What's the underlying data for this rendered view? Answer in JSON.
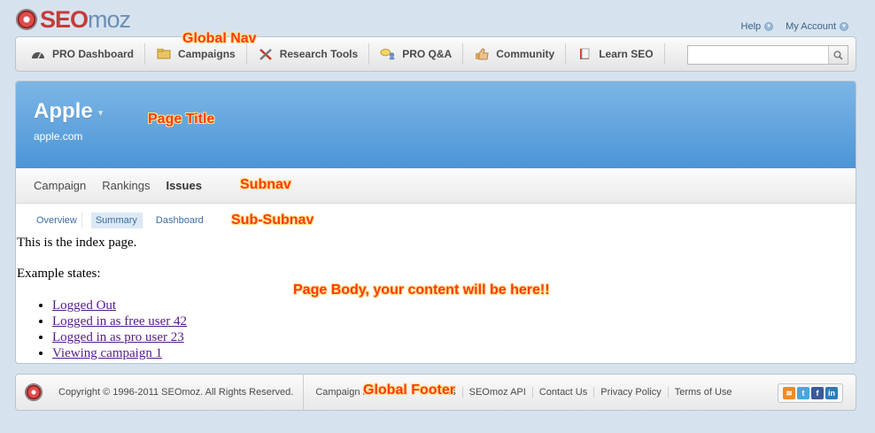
{
  "logo": {
    "part1": "SEO",
    "part2": "moz"
  },
  "top_links": [
    {
      "label": "Help"
    },
    {
      "label": "My Account"
    }
  ],
  "global_nav": {
    "items": [
      {
        "label": "PRO Dashboard",
        "icon": "speedometer-icon"
      },
      {
        "label": "Campaigns",
        "icon": "folder-icon"
      },
      {
        "label": "Research Tools",
        "icon": "tools-icon"
      },
      {
        "label": "PRO Q&A",
        "icon": "chat-icon"
      },
      {
        "label": "Community",
        "icon": "thumbs-up-icon"
      },
      {
        "label": "Learn SEO",
        "icon": "book-icon"
      }
    ],
    "search_placeholder": ""
  },
  "page": {
    "title": "Apple",
    "subtitle": "apple.com"
  },
  "subnav": [
    {
      "label": "Campaign"
    },
    {
      "label": "Rankings"
    },
    {
      "label": "Issues",
      "active": true
    }
  ],
  "subsubnav": [
    {
      "label": "Overview"
    },
    {
      "label": "Summary",
      "active": true
    },
    {
      "label": "Dashboard"
    }
  ],
  "body": {
    "intro": "This is the index page.",
    "example_heading": "Example states:",
    "links": [
      "Logged Out",
      "Logged in as free user 42",
      "Logged in as pro user 23",
      "Viewing campaign 1"
    ]
  },
  "footer": {
    "copyright": "Copyright © 1996-2011 SEOmoz. All Rights Reserved.",
    "links": [
      "Campaign M",
      "ls",
      "SEOmoz API",
      "Contact Us",
      "Privacy Policy",
      "Terms of Use"
    ],
    "social": [
      "rss-icon",
      "twitter-icon",
      "facebook-icon",
      "linkedin-icon"
    ]
  },
  "annotations": {
    "global_nav": "Global Nav",
    "page_title": "Page Title",
    "subnav": "Subnav",
    "sub_subnav": "Sub-Subnav",
    "page_body": "Page Body, your content will be here!!",
    "global_footer": "Global Footer"
  },
  "colors": {
    "title_bar": "#5fa6df",
    "annotation": "#ff3b12",
    "page_bg": "#d6e3ef"
  }
}
